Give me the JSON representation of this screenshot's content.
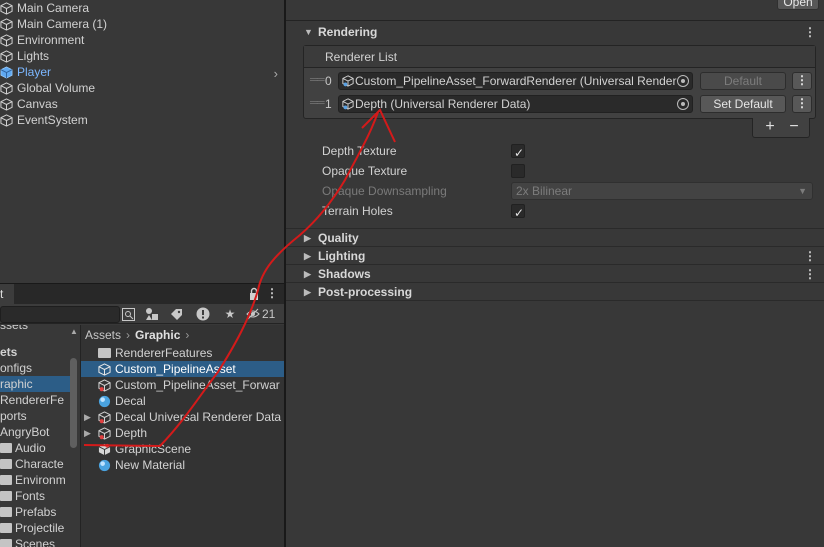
{
  "hierarchy": {
    "items": [
      {
        "label": "Main Camera"
      },
      {
        "label": "Main Camera (1)"
      },
      {
        "label": "Environment"
      },
      {
        "label": "Lights"
      },
      {
        "label": "Player"
      },
      {
        "label": "Global Volume"
      },
      {
        "label": "Canvas"
      },
      {
        "label": "EventSystem"
      }
    ]
  },
  "project": {
    "tab_label": "t",
    "hidden_count": "21",
    "tree": [
      {
        "label": "ssets"
      },
      {
        "label": "ets"
      },
      {
        "label": "onfigs"
      },
      {
        "label": "raphic"
      },
      {
        "label": "RendererFe"
      },
      {
        "label": "ports"
      },
      {
        "label": "AngryBot"
      },
      {
        "label": "Audio"
      },
      {
        "label": "Characte"
      },
      {
        "label": "Environm"
      },
      {
        "label": "Fonts"
      },
      {
        "label": "Prefabs"
      },
      {
        "label": "Projectile"
      },
      {
        "label": "Scenes"
      }
    ],
    "breadcrumb": {
      "root": "Assets",
      "current": "Graphic"
    },
    "assets": [
      {
        "label": "RendererFeatures"
      },
      {
        "label": "Custom_PipelineAsset"
      },
      {
        "label": "Custom_PipelineAsset_Forwar"
      },
      {
        "label": "Decal"
      },
      {
        "label": "Decal Universal Renderer Data"
      },
      {
        "label": "Depth"
      },
      {
        "label": "GraphicScene"
      },
      {
        "label": "New Material"
      }
    ]
  },
  "inspector": {
    "open_label": "Open",
    "rendering_label": "Rendering",
    "renderer_list_label": "Renderer List",
    "renderers": [
      {
        "index": "0",
        "value": "Custom_PipelineAsset_ForwardRenderer (Universal Render",
        "button": "Default"
      },
      {
        "index": "1",
        "value": "Depth (Universal Renderer Data)",
        "button": "Set Default"
      }
    ],
    "plus_label": "+",
    "minus_label": "−",
    "props": {
      "depth_texture": "Depth Texture",
      "opaque_texture": "Opaque Texture",
      "opaque_downsampling": "Opaque Downsampling",
      "opaque_downsampling_value": "2x Bilinear",
      "terrain_holes": "Terrain Holes"
    },
    "sections": {
      "quality": "Quality",
      "lighting": "Lighting",
      "shadows": "Shadows",
      "post_processing": "Post-processing"
    }
  },
  "colors": {
    "selection": "#2c5d87",
    "player_text": "#7cb7ff",
    "annotation": "#d41a1a"
  }
}
